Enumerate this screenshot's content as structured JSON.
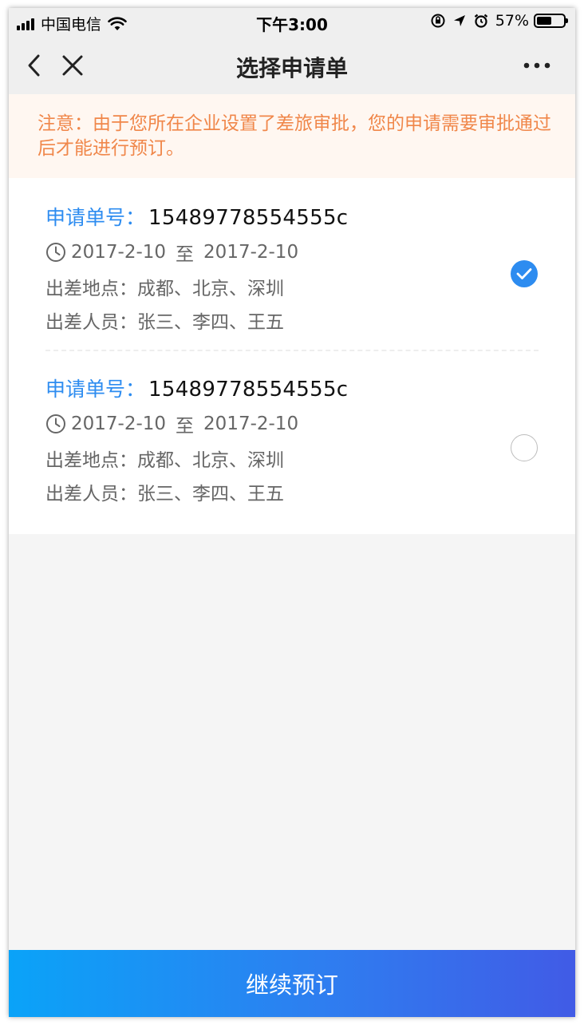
{
  "status_bar": {
    "carrier": "中国电信",
    "time": "下午3:00",
    "battery": "57%",
    "battery_level": 0.57,
    "icons": [
      "signal-icon",
      "wifi-icon",
      "orientation-lock-icon",
      "location-icon",
      "alarm-icon",
      "battery-icon"
    ]
  },
  "nav": {
    "title": "选择申请单",
    "icons": [
      "back-icon",
      "close-icon",
      "more-icon"
    ]
  },
  "notice": {
    "text": "注意：由于您所在企业设置了差旅审批，您的申请需要审批通过后才能进行预订。"
  },
  "requests": [
    {
      "number_label": "申请单号：",
      "number": "15489778554555c",
      "date_from": "2017-2-10",
      "date_sep": "至",
      "date_to": "2017-2-10",
      "location": "出差地点：成都、北京、深圳",
      "travelers": "出差人员：张三、李四、王五",
      "selected": true
    },
    {
      "number_label": "申请单号：",
      "number": "15489778554555c",
      "date_from": "2017-2-10",
      "date_sep": "至",
      "date_to": "2017-2-10",
      "location": "出差地点：成都、北京、深圳",
      "travelers": "出差人员：张三、李四、王五",
      "selected": false
    }
  ],
  "continue_button": {
    "label": "继续预订"
  },
  "colors": {
    "accent": "#2d8cf0",
    "notice_text": "#f0874a",
    "notice_bg": "#fff7f1",
    "button_gradient_start": "#0aa3f8",
    "button_gradient_end": "#415be6"
  }
}
